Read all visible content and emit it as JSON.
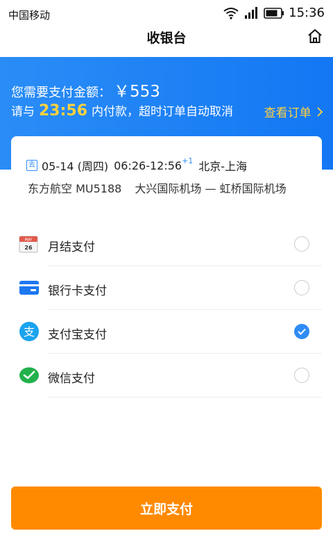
{
  "status_bar": {
    "carrier": "中国移动",
    "time": "15:36"
  },
  "header": {
    "title": "收银台"
  },
  "banner": {
    "amount_label": "您需要支付金额：",
    "amount_value": "￥553",
    "deadline_prefix": "请与",
    "deadline_time": "23:56",
    "deadline_suffix": "内付款，超时订单自动取消",
    "view_order_label": "查看订单"
  },
  "flight": {
    "tag": "去",
    "date": "05-14 (周四)",
    "time_range": "06:26-12:56",
    "day_offset": "+1",
    "route": "北京-上海",
    "airline_flight": "东方航空 MU5188",
    "airports": "大兴国际机场 — 虹桥国际机场"
  },
  "payment_methods": [
    {
      "label": "月结支付",
      "icon": "calendar-icon",
      "selected": false
    },
    {
      "label": "银行卡支付",
      "icon": "bank-card-icon",
      "selected": false
    },
    {
      "label": "支付宝支付",
      "icon": "alipay-icon",
      "selected": true
    },
    {
      "label": "微信支付",
      "icon": "wechat-pay-icon",
      "selected": false
    }
  ],
  "calendar_icon": {
    "month": "MAY",
    "day": "26"
  },
  "pay_button_label": "立即支付",
  "colors": {
    "banner_blue": "#1a80f5",
    "highlight_yellow": "#ffd23f",
    "pay_orange": "#ff8a00",
    "check_blue": "#2f8cf5"
  }
}
